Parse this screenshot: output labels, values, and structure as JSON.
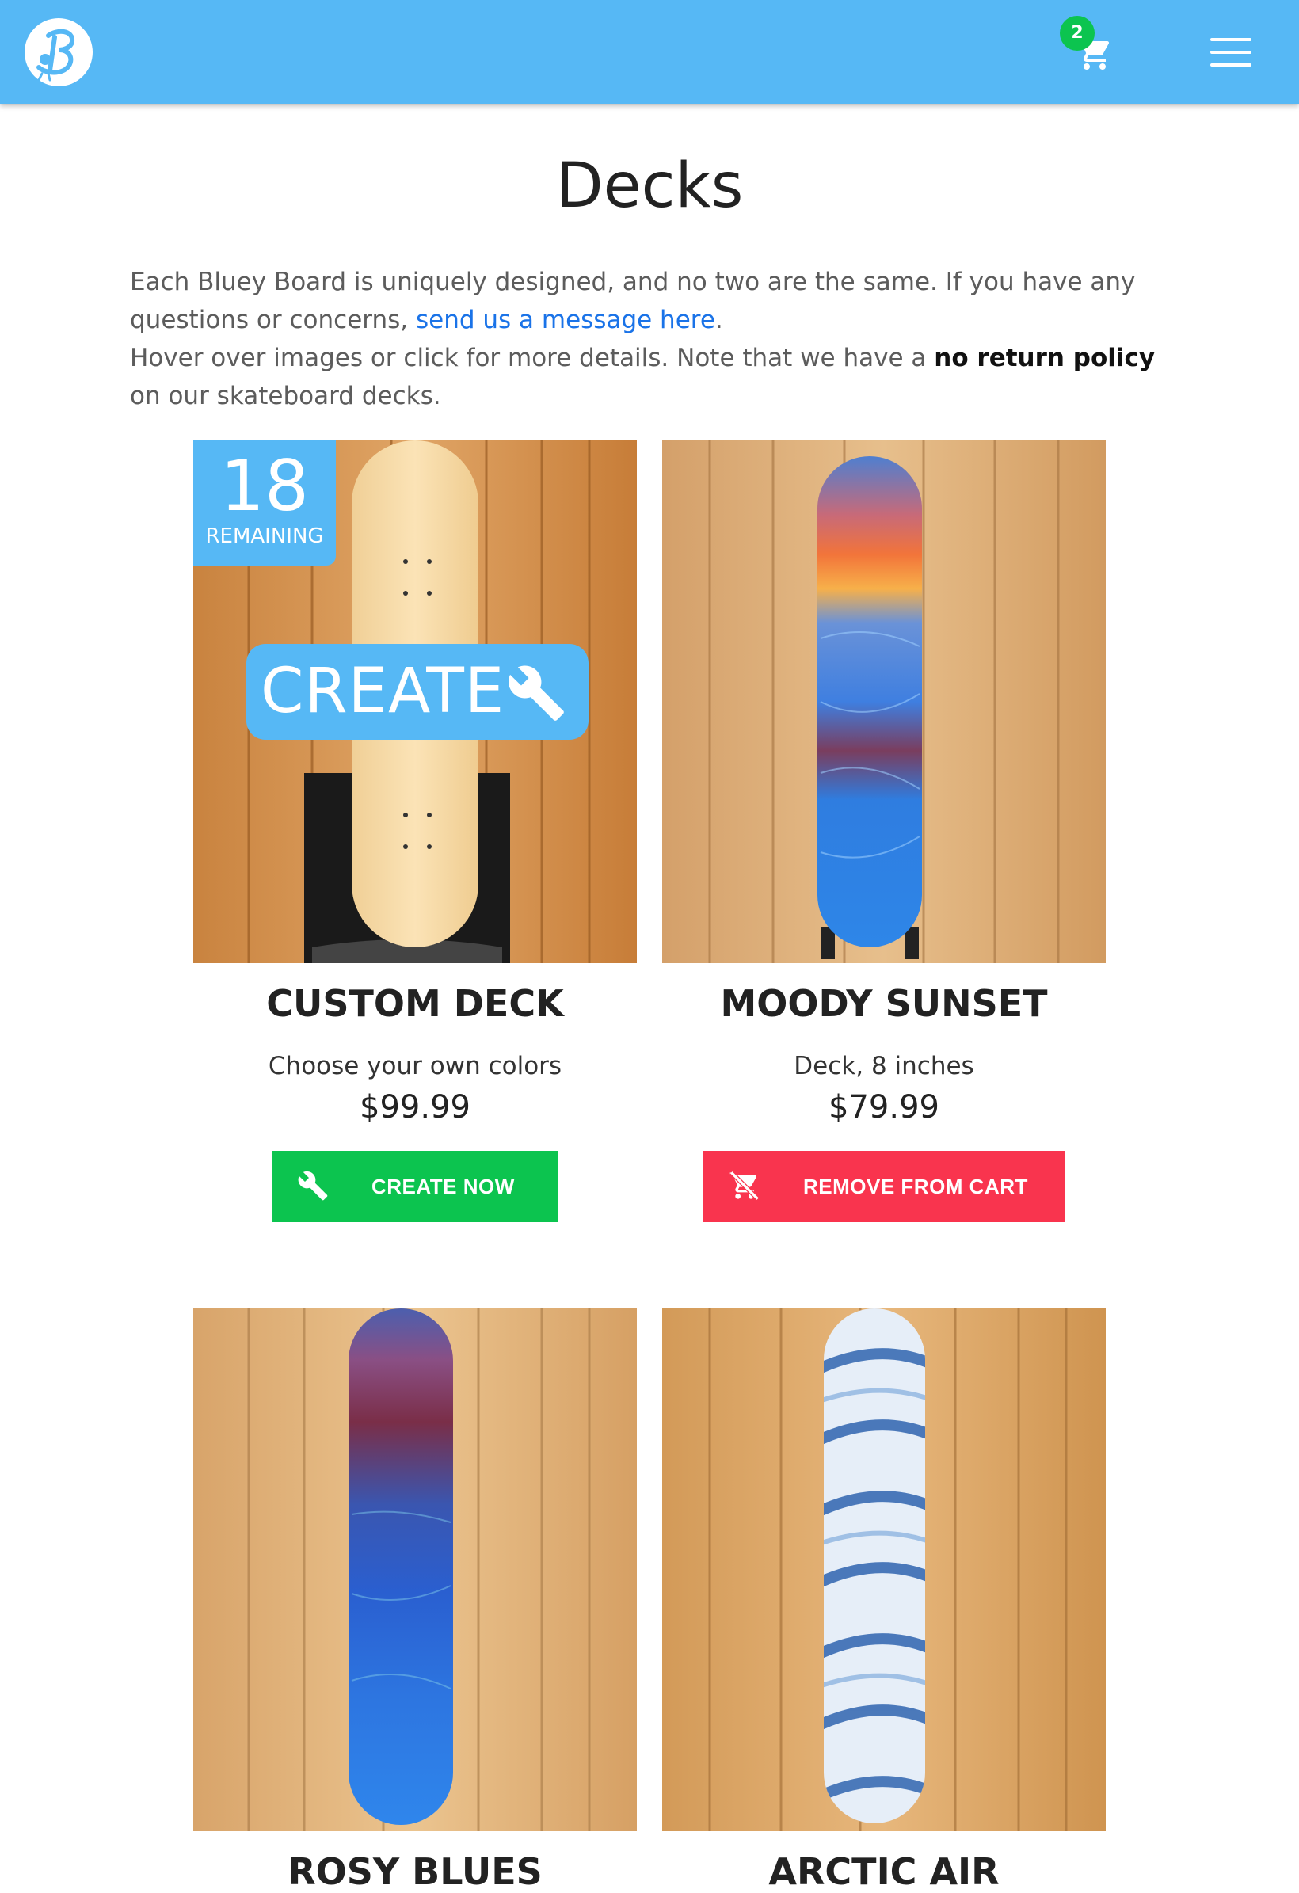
{
  "nav": {
    "logo_icon": "bluey-bird-logo",
    "cart_icon": "cart-icon",
    "cart_count": "2",
    "menu_icon": "hamburger-menu-icon",
    "brand_color": "#56b8f5"
  },
  "page": {
    "title": "Decks",
    "intro_line1_before": "Each Bluey Board is uniquely designed, and no two are the same. If you have any questions or concerns, ",
    "intro_link": "send us a message here",
    "intro_line1_after": ".",
    "intro_line2_before": "Hover over images or click for more details. Note that we have a ",
    "intro_bold": "no return policy",
    "intro_line2_after": " on our skateboard decks."
  },
  "products": [
    {
      "title": "CUSTOM DECK",
      "subtitle": "Choose your own colors",
      "price": "$99.99",
      "remaining_count": "18",
      "remaining_label": "REMAINING",
      "overlay_label": "CREATE",
      "overlay_icon": "wrench-icon",
      "button_label": "CREATE NOW",
      "button_icon": "wrench-icon",
      "button_color": "#0cc44f"
    },
    {
      "title": "MOODY SUNSET",
      "subtitle": "Deck, 8 inches",
      "price": "$79.99",
      "button_label": "REMOVE FROM CART",
      "button_icon": "remove-from-cart-icon",
      "button_color": "#f9344e"
    },
    {
      "title": "ROSY BLUES"
    },
    {
      "title": "ARCTIC AIR"
    }
  ]
}
